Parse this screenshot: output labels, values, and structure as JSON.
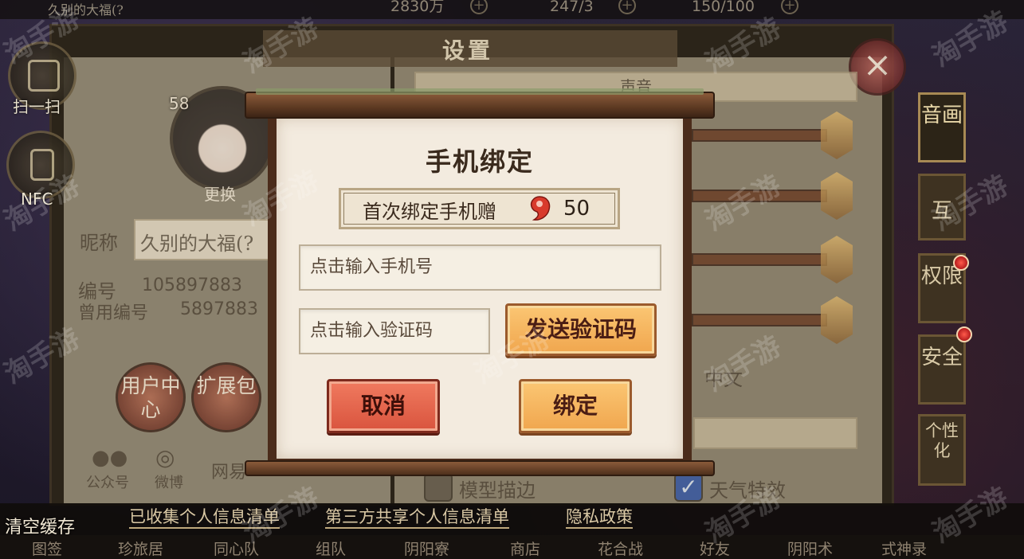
{
  "topbar": {
    "player_fragment": "久别的大福(?",
    "gold": "2830万",
    "stamina": "247/3",
    "gouyu": "150/100",
    "plus": "+"
  },
  "side": {
    "scan_label": "扫一扫",
    "nfc_label": "NFC"
  },
  "settings": {
    "title": "设置",
    "close_icon": "×",
    "profile": {
      "level": "58",
      "change_label": "更换",
      "nickname_label": "昵称",
      "nickname_value": "久别的大福(?",
      "id_label": "编号",
      "id_value": "105897883",
      "old_id_label": "曾用编号",
      "old_id_value": "5897883",
      "user_center": "用户中心",
      "expansion": "扩展包",
      "wechat_label": "公众号",
      "weibo_label": "微博",
      "netease_fragment": "网易"
    },
    "right": {
      "sound_header": "声音",
      "language_value": "中文",
      "model_outline": "模型描边",
      "weather_effects": "天气特效",
      "check_mark": "✓"
    },
    "tabs": [
      "音画",
      "互",
      "权限",
      "安全",
      "个性化"
    ]
  },
  "bottom": {
    "clear_cache": "清空缓存",
    "links": [
      "已收集个人信息清单",
      "第三方共享个人信息清单",
      "隐私政策"
    ],
    "nav": [
      "图签",
      "珍旅居",
      "同心队",
      "组队",
      "阴阳寮",
      "商店",
      "花合战",
      "好友",
      "阴阳术",
      "式神录"
    ]
  },
  "modal": {
    "title": "手机绑定",
    "bonus_text": "首次绑定手机赠",
    "bonus_amount": "50",
    "bonus_icon": "magatama-icon",
    "phone_placeholder": "点击输入手机号",
    "code_placeholder": "点击输入验证码",
    "send_code_label": "发送验证码",
    "cancel_label": "取消",
    "bind_label": "绑定"
  },
  "watermark": "淘手游",
  "colors": {
    "scroll_paper": "#f3ebdf",
    "orange_button": "#f0a64e",
    "red_button": "#d9543e",
    "wood": "#5c3922"
  }
}
